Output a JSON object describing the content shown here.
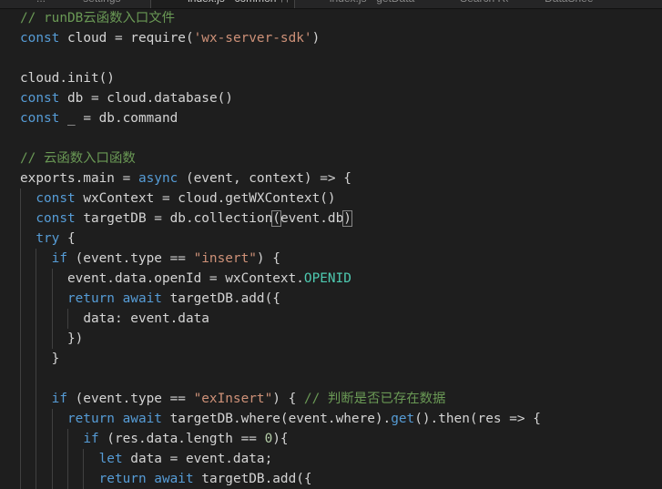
{
  "tabs": [
    {
      "label": "...index"
    },
    {
      "label": "settings"
    },
    {
      "label": "index.js - common ↑↑",
      "active": true
    },
    {
      "label": "index.js - getData"
    },
    {
      "label": "Search Result"
    },
    {
      "label": "DataSheet"
    }
  ],
  "lines": [
    {
      "indent": 0,
      "tokens": [
        [
          "// runDB云函数入口文件",
          "cm"
        ]
      ]
    },
    {
      "indent": 0,
      "tokens": [
        [
          "const",
          "kw"
        ],
        [
          " cloud = require(",
          "tx"
        ],
        [
          "'wx-server-sdk'",
          "str"
        ],
        [
          ")",
          "tx"
        ]
      ]
    },
    {
      "indent": 0,
      "tokens": []
    },
    {
      "indent": 0,
      "tokens": [
        [
          "cloud.init()",
          "tx"
        ]
      ]
    },
    {
      "indent": 0,
      "tokens": [
        [
          "const",
          "kw"
        ],
        [
          " db = cloud.database()",
          "tx"
        ]
      ]
    },
    {
      "indent": 0,
      "tokens": [
        [
          "const",
          "kw"
        ],
        [
          " _ = db.command",
          "tx"
        ]
      ]
    },
    {
      "indent": 0,
      "tokens": []
    },
    {
      "indent": 0,
      "tokens": [
        [
          "// 云函数入口函数",
          "cm"
        ]
      ]
    },
    {
      "indent": 0,
      "tokens": [
        [
          "exports.main = ",
          "tx"
        ],
        [
          "async",
          "kw"
        ],
        [
          " (event, context) => {",
          "tx"
        ]
      ]
    },
    {
      "indent": 1,
      "tokens": [
        [
          "const",
          "kw"
        ],
        [
          " wxContext = cloud.getWXContext()",
          "tx"
        ]
      ]
    },
    {
      "indent": 1,
      "tokens": [
        [
          "const",
          "kw"
        ],
        [
          " targetDB = db.collection",
          "tx"
        ],
        [
          "(",
          "br"
        ],
        [
          "event.db",
          "tx"
        ],
        [
          ")",
          "br"
        ]
      ]
    },
    {
      "indent": 1,
      "tokens": [
        [
          "try",
          "kw"
        ],
        [
          " {",
          "tx"
        ]
      ]
    },
    {
      "indent": 2,
      "tokens": [
        [
          "if",
          "kw"
        ],
        [
          " (event.type == ",
          "tx"
        ],
        [
          "\"insert\"",
          "str"
        ],
        [
          ") {",
          "tx"
        ]
      ]
    },
    {
      "indent": 3,
      "tokens": [
        [
          "event.data.openId = wxContext.",
          "tx"
        ],
        [
          "OPENID",
          "cst"
        ]
      ]
    },
    {
      "indent": 3,
      "tokens": [
        [
          "return",
          "kw"
        ],
        [
          " ",
          "tx"
        ],
        [
          "await",
          "kw"
        ],
        [
          " targetDB.add({",
          "tx"
        ]
      ]
    },
    {
      "indent": 4,
      "tokens": [
        [
          "data: event.data",
          "tx"
        ]
      ]
    },
    {
      "indent": 3,
      "tokens": [
        [
          "})",
          "tx"
        ]
      ]
    },
    {
      "indent": 2,
      "tokens": [
        [
          "}",
          "tx"
        ]
      ]
    },
    {
      "indent": 2,
      "tokens": [],
      "guides": 2
    },
    {
      "indent": 2,
      "tokens": [
        [
          "if",
          "kw"
        ],
        [
          " (event.type == ",
          "tx"
        ],
        [
          "\"exInsert\"",
          "str"
        ],
        [
          ") { ",
          "tx"
        ],
        [
          "// 判断是否已存在数据",
          "cm"
        ]
      ]
    },
    {
      "indent": 3,
      "tokens": [
        [
          "return",
          "kw"
        ],
        [
          " ",
          "tx"
        ],
        [
          "await",
          "kw"
        ],
        [
          " targetDB.where(event.where).",
          "tx"
        ],
        [
          "get",
          "kw"
        ],
        [
          "().then(res => {",
          "tx"
        ]
      ]
    },
    {
      "indent": 4,
      "tokens": [
        [
          "if",
          "kw"
        ],
        [
          " (res.data.length == ",
          "tx"
        ],
        [
          "0",
          "num"
        ],
        [
          "){",
          "tx"
        ]
      ]
    },
    {
      "indent": 5,
      "tokens": [
        [
          "let",
          "kw"
        ],
        [
          " data = event.data;",
          "tx"
        ]
      ]
    },
    {
      "indent": 5,
      "tokens": [
        [
          "return",
          "kw"
        ],
        [
          " ",
          "tx"
        ],
        [
          "await",
          "kw"
        ],
        [
          " targetDB.add({",
          "tx"
        ]
      ]
    }
  ]
}
